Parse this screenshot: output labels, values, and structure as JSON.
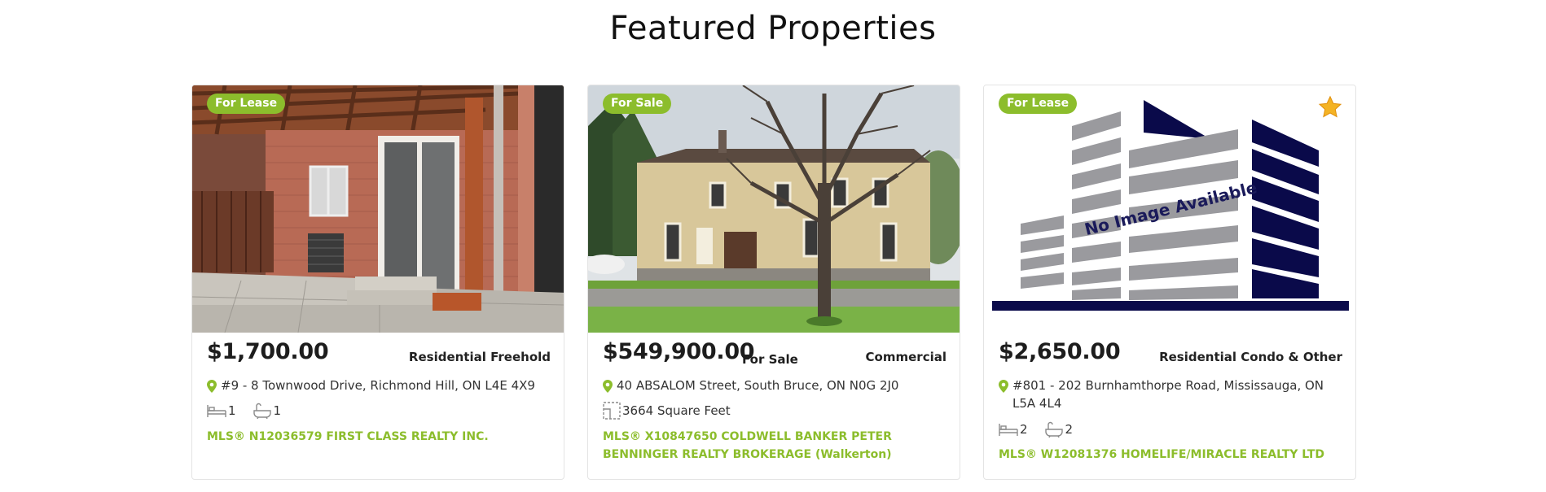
{
  "section": {
    "title": "Featured Properties"
  },
  "colors": {
    "accent": "#8cbd2c",
    "text": "#222222",
    "border": "#e4e4e4"
  },
  "listings": [
    {
      "status": "For Lease",
      "price": "$1,700.00",
      "price_suffix": "",
      "property_type": "Residential Freehold",
      "address": "#9 - 8 Townwood Drive, Richmond Hill, ON L4E 4X9",
      "beds": "1",
      "baths": "1",
      "mls": "MLS® N12036579 FIRST CLASS REALTY INC.",
      "image": "brick-patio-photo"
    },
    {
      "status": "For Sale",
      "price": "$549,900.00",
      "price_suffix": "For Sale",
      "property_type": "Commercial",
      "address": "40 ABSALOM Street, South Bruce, ON N0G 2J0",
      "area": "3664 Square Feet",
      "mls": "MLS® X10847650 COLDWELL BANKER PETER BENNINGER REALTY BROKERAGE (Walkerton)",
      "image": "brick-house-with-tree-photo"
    },
    {
      "status": "For Lease",
      "price": "$2,650.00",
      "price_suffix": "",
      "property_type": "Residential Condo & Other",
      "address": "#801 - 202 Burnhamthorpe Road, Mississauga, ON L5A 4L4",
      "beds": "2",
      "baths": "2",
      "mls": "MLS® W12081376 HOMELIFE/MIRACLE REALTY LTD",
      "image": "no-image-placeholder",
      "image_text": "No Image Available",
      "featured_icon": "star-icon"
    }
  ]
}
